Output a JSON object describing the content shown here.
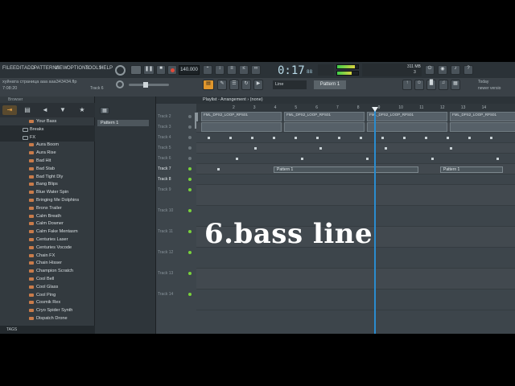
{
  "menu": [
    "FILE",
    "EDIT",
    "ADD",
    "PATTERNS",
    "VIEW",
    "OPTIONS",
    "TOOLS",
    "HELP"
  ],
  "hint_line1": "хуйната страница  ааа  ааа343434.flp",
  "hint_line2": "7:08:20",
  "hint_track": "Track 6",
  "bpm": "140.000",
  "time": "0:17",
  "time_sub": "88",
  "pattern_selector": "Pattern 1",
  "snap": "Line",
  "cpu_value": "311 MB",
  "cpu_poly": "3",
  "news_title": "Today",
  "news_sub": "newer versio",
  "browser": {
    "header": "Browser",
    "footer": "TAGS",
    "items": [
      {
        "label": "Your Bass",
        "type": "file"
      },
      {
        "label": "Breaks",
        "type": "folder"
      },
      {
        "label": "FX",
        "type": "folder"
      },
      {
        "label": "Aura Boom",
        "type": "file"
      },
      {
        "label": "Aura Rise",
        "type": "file"
      },
      {
        "label": "Bad Hit",
        "type": "file"
      },
      {
        "label": "Bad Stab",
        "type": "file"
      },
      {
        "label": "Bad Tight Dly",
        "type": "file"
      },
      {
        "label": "Bang Blips",
        "type": "file"
      },
      {
        "label": "Blue Water Spin",
        "type": "file"
      },
      {
        "label": "Bringing Me Dolphins",
        "type": "file"
      },
      {
        "label": "Bronx Trailer",
        "type": "file"
      },
      {
        "label": "Calm Breath",
        "type": "file"
      },
      {
        "label": "Calm Downer",
        "type": "file"
      },
      {
        "label": "Calm Fake Mentasm",
        "type": "file"
      },
      {
        "label": "Centuries Laser",
        "type": "file"
      },
      {
        "label": "Centuries Vocode",
        "type": "file"
      },
      {
        "label": "Chain FX",
        "type": "file"
      },
      {
        "label": "Chain Hisser",
        "type": "file"
      },
      {
        "label": "Champion Scratch",
        "type": "file"
      },
      {
        "label": "Cool Bell",
        "type": "file"
      },
      {
        "label": "Cool Glass",
        "type": "file"
      },
      {
        "label": "Cool Ping",
        "type": "file"
      },
      {
        "label": "Cosmik Rex",
        "type": "file"
      },
      {
        "label": "Cryo Spider Synth",
        "type": "file"
      },
      {
        "label": "Dispatch Drone",
        "type": "file"
      }
    ]
  },
  "picker": {
    "pattern": "Pattern 1"
  },
  "playlist": {
    "title": "Playlist - Arrangement › (none)",
    "ruler": [
      "2",
      "3",
      "4",
      "5",
      "6",
      "7",
      "8",
      "9",
      "10",
      "11",
      "12",
      "13",
      "14"
    ],
    "tracks": [
      "Track 2",
      "Track 3",
      "Track 4",
      "Track 5",
      "Track 6",
      "Track 7",
      "Track 8",
      "Track 9",
      "Track 10",
      "Track 11",
      "Track 12",
      "Track 13",
      "Track 14"
    ],
    "loop_clip_label": "FML_DPS2_LOOP_RPS01",
    "pattern_clips": [
      "Pattern 1",
      "Pattern 1"
    ]
  },
  "overlay_caption": "6.bass line"
}
